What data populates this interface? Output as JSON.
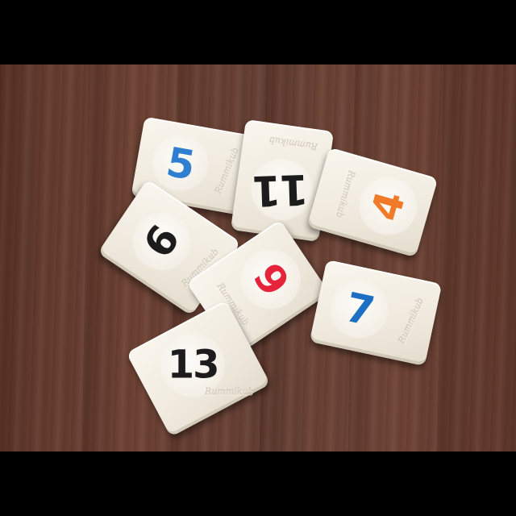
{
  "scene": {
    "description_colors": {
      "table_wood": "#653d31",
      "tile_face": "#f3eee4"
    }
  },
  "tiles": [
    {
      "number": "5",
      "color": "#2e7fd0",
      "brand": "Rummikub",
      "icon": "rummikub-tile"
    },
    {
      "number": "11",
      "color": "#1c1c1c",
      "brand": "Rummikub",
      "icon": "rummikub-tile"
    },
    {
      "number": "4",
      "color": "#f07a28",
      "brand": "Rummikub",
      "icon": "rummikub-tile"
    },
    {
      "number": "6",
      "color": "#1c1c1c",
      "brand": "Rummikub",
      "icon": "rummikub-tile"
    },
    {
      "number": "9",
      "color": "#e5233a",
      "brand": "Rummikub",
      "icon": "rummikub-tile"
    },
    {
      "number": "7",
      "color": "#1d6fc4",
      "brand": "Rummikub",
      "icon": "rummikub-tile"
    },
    {
      "number": "13",
      "color": "#1c1c1c",
      "brand": "Rummikub",
      "icon": "rummikub-tile"
    }
  ]
}
